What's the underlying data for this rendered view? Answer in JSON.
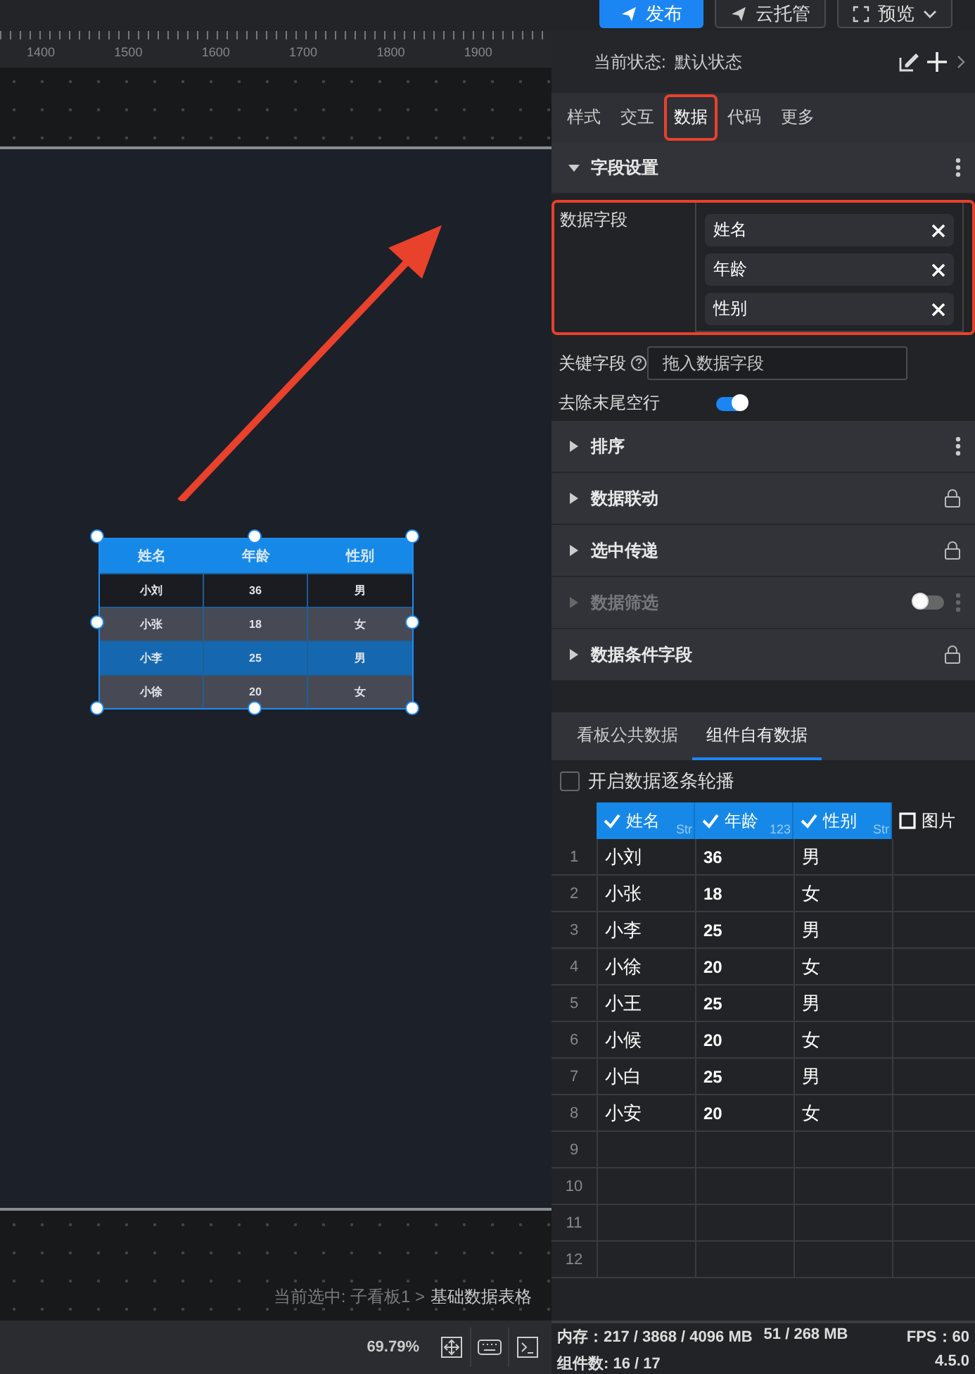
{
  "toolbar": {
    "buttons": [
      {
        "label": "发布",
        "kind": "primary"
      },
      {
        "label": "云托管",
        "kind": "default"
      },
      {
        "label": "预览",
        "kind": "dropdown"
      }
    ]
  },
  "ruler": {
    "labels": [
      "1400",
      "1500",
      "1600",
      "1700",
      "1800",
      "1900"
    ]
  },
  "widget": {
    "columns": [
      "姓名",
      "年龄",
      "性别"
    ],
    "rows": [
      {
        "cells": [
          "小刘",
          "36",
          "男"
        ],
        "selected": false
      },
      {
        "cells": [
          "小张",
          "18",
          "女"
        ],
        "selected": false
      },
      {
        "cells": [
          "小李",
          "25",
          "男"
        ],
        "selected": true
      },
      {
        "cells": [
          "小徐",
          "20",
          "女"
        ],
        "selected": false
      }
    ]
  },
  "breadcrumb": {
    "prefix": "当前选中: 子看板1 >",
    "current": "基础数据表格"
  },
  "zoom": "69.79%",
  "panel": {
    "state_label": "当前状态:",
    "state_value": "默认状态",
    "tabs": [
      {
        "label": "样式",
        "selected": false,
        "highlighted": false
      },
      {
        "label": "交互",
        "selected": false,
        "highlighted": false
      },
      {
        "label": "数据",
        "selected": true,
        "highlighted": true
      },
      {
        "label": "代码",
        "selected": false,
        "highlighted": false
      },
      {
        "label": "更多",
        "selected": false,
        "highlighted": false
      }
    ],
    "field_section": {
      "title": "字段设置",
      "expanded": true,
      "data_fields": {
        "label": "数据字段",
        "highlighted": true,
        "chips": [
          "姓名",
          "年龄",
          "性别"
        ]
      },
      "key_field": {
        "label": "关键字段",
        "placeholder": "拖入数据字段"
      },
      "trim": {
        "label": "去除末尾空行",
        "on": true
      }
    },
    "sections": [
      {
        "title": "排序",
        "expanded": false,
        "disabled": false,
        "kind": "menu"
      },
      {
        "title": "数据联动",
        "expanded": false,
        "disabled": false,
        "kind": "locked"
      },
      {
        "title": "选中传递",
        "expanded": false,
        "disabled": false,
        "kind": "locked"
      },
      {
        "title": "数据筛选",
        "expanded": false,
        "disabled": true,
        "kind": "menu",
        "switch_on": false
      },
      {
        "title": "数据条件字段",
        "expanded": false,
        "disabled": false,
        "kind": "locked"
      }
    ],
    "data_tabs": [
      {
        "label": "看板公共数据",
        "selected": false
      },
      {
        "label": "组件自有数据",
        "selected": true
      }
    ],
    "carousel": {
      "label": "开启数据逐条轮播",
      "checked": false
    },
    "grid": {
      "columns": [
        {
          "name": "姓名",
          "type": "Str",
          "checked": true
        },
        {
          "name": "年龄",
          "type": "123",
          "checked": true
        },
        {
          "name": "性别",
          "type": "Str",
          "checked": true
        },
        {
          "name": "图片",
          "checked": false
        }
      ],
      "rows": [
        {
          "index": "1",
          "cells": [
            "小刘",
            "36",
            "男"
          ]
        },
        {
          "index": "2",
          "cells": [
            "小张",
            "18",
            "女"
          ]
        },
        {
          "index": "3",
          "cells": [
            "小李",
            "25",
            "男"
          ]
        },
        {
          "index": "4",
          "cells": [
            "小徐",
            "20",
            "女"
          ]
        },
        {
          "index": "5",
          "cells": [
            "小王",
            "25",
            "男"
          ]
        },
        {
          "index": "6",
          "cells": [
            "小候",
            "20",
            "女"
          ]
        },
        {
          "index": "7",
          "cells": [
            "小白",
            "25",
            "男"
          ]
        },
        {
          "index": "8",
          "cells": [
            "小安",
            "20",
            "女"
          ]
        },
        {
          "index": "9"
        },
        {
          "index": "10"
        },
        {
          "index": "11"
        },
        {
          "index": "12"
        }
      ]
    }
  },
  "status": {
    "memory": "内存：217 / 3868 / 4096 MB",
    "gpu_memory": "51 / 268 MB",
    "fps": "FPS：60",
    "components": "组件数: 16 / 17",
    "version": "4.5.0"
  }
}
